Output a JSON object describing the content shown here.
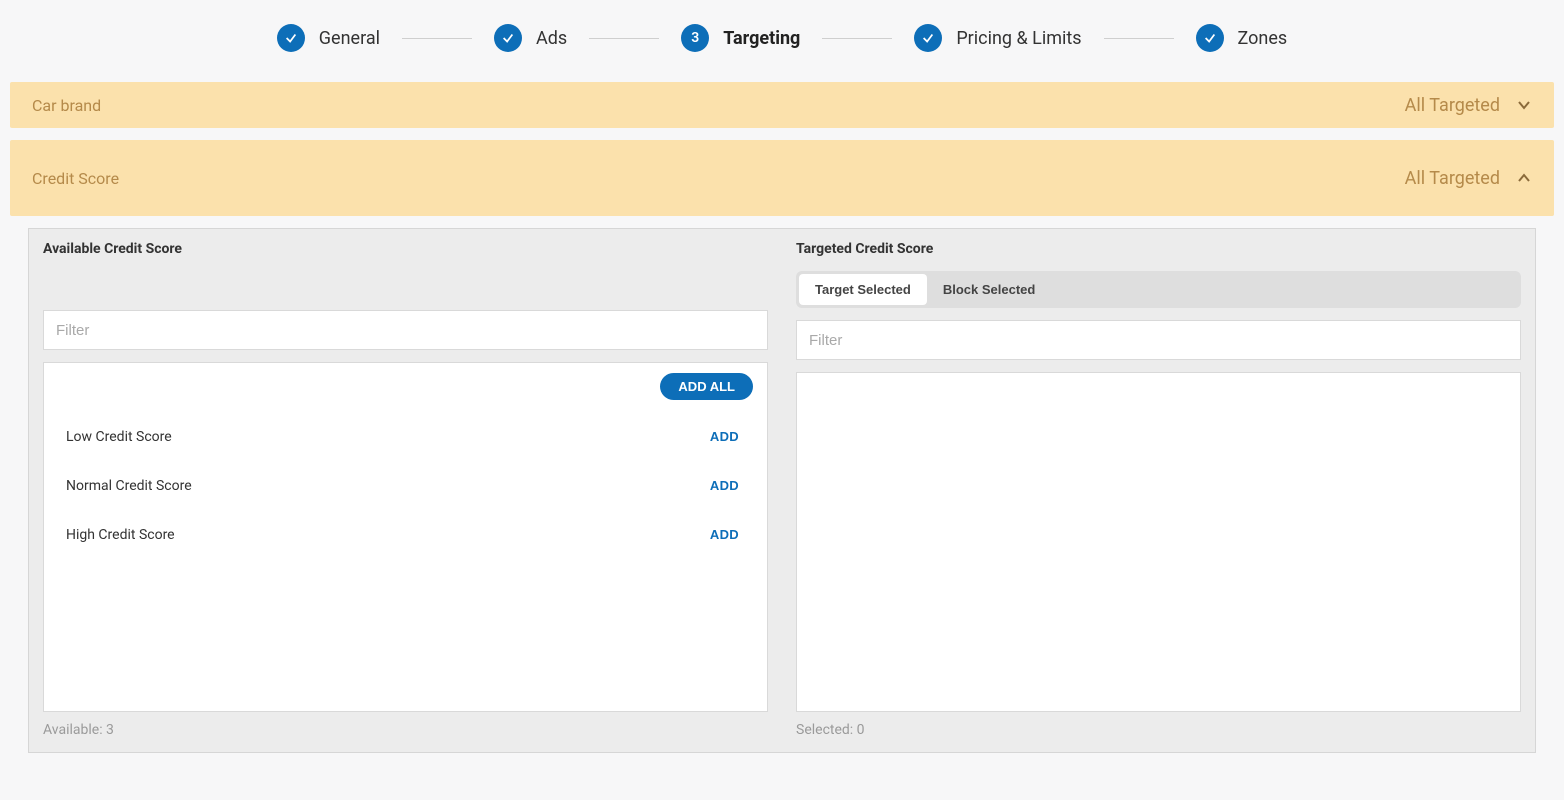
{
  "stepper": {
    "steps": [
      {
        "label": "General",
        "state": "done"
      },
      {
        "label": "Ads",
        "state": "done"
      },
      {
        "label": "Targeting",
        "state": "current",
        "number": "3"
      },
      {
        "label": "Pricing & Limits",
        "state": "done"
      },
      {
        "label": "Zones",
        "state": "done"
      }
    ]
  },
  "sections": {
    "car_brand": {
      "title": "Car brand",
      "status": "All Targeted"
    },
    "credit_score": {
      "title": "Credit Score",
      "status": "All Targeted"
    }
  },
  "credit_score_panel": {
    "available_title": "Available Credit Score",
    "targeted_title": "Targeted Credit Score",
    "filter_placeholder": "Filter",
    "add_all_label": "ADD ALL",
    "add_label": "ADD",
    "toggle": {
      "target": "Target Selected",
      "block": "Block Selected"
    },
    "available_items": [
      {
        "label": "Low Credit Score"
      },
      {
        "label": "Normal Credit Score"
      },
      {
        "label": "High Credit Score"
      }
    ],
    "available_count_label": "Available: 3",
    "selected_count_label": "Selected: 0"
  }
}
